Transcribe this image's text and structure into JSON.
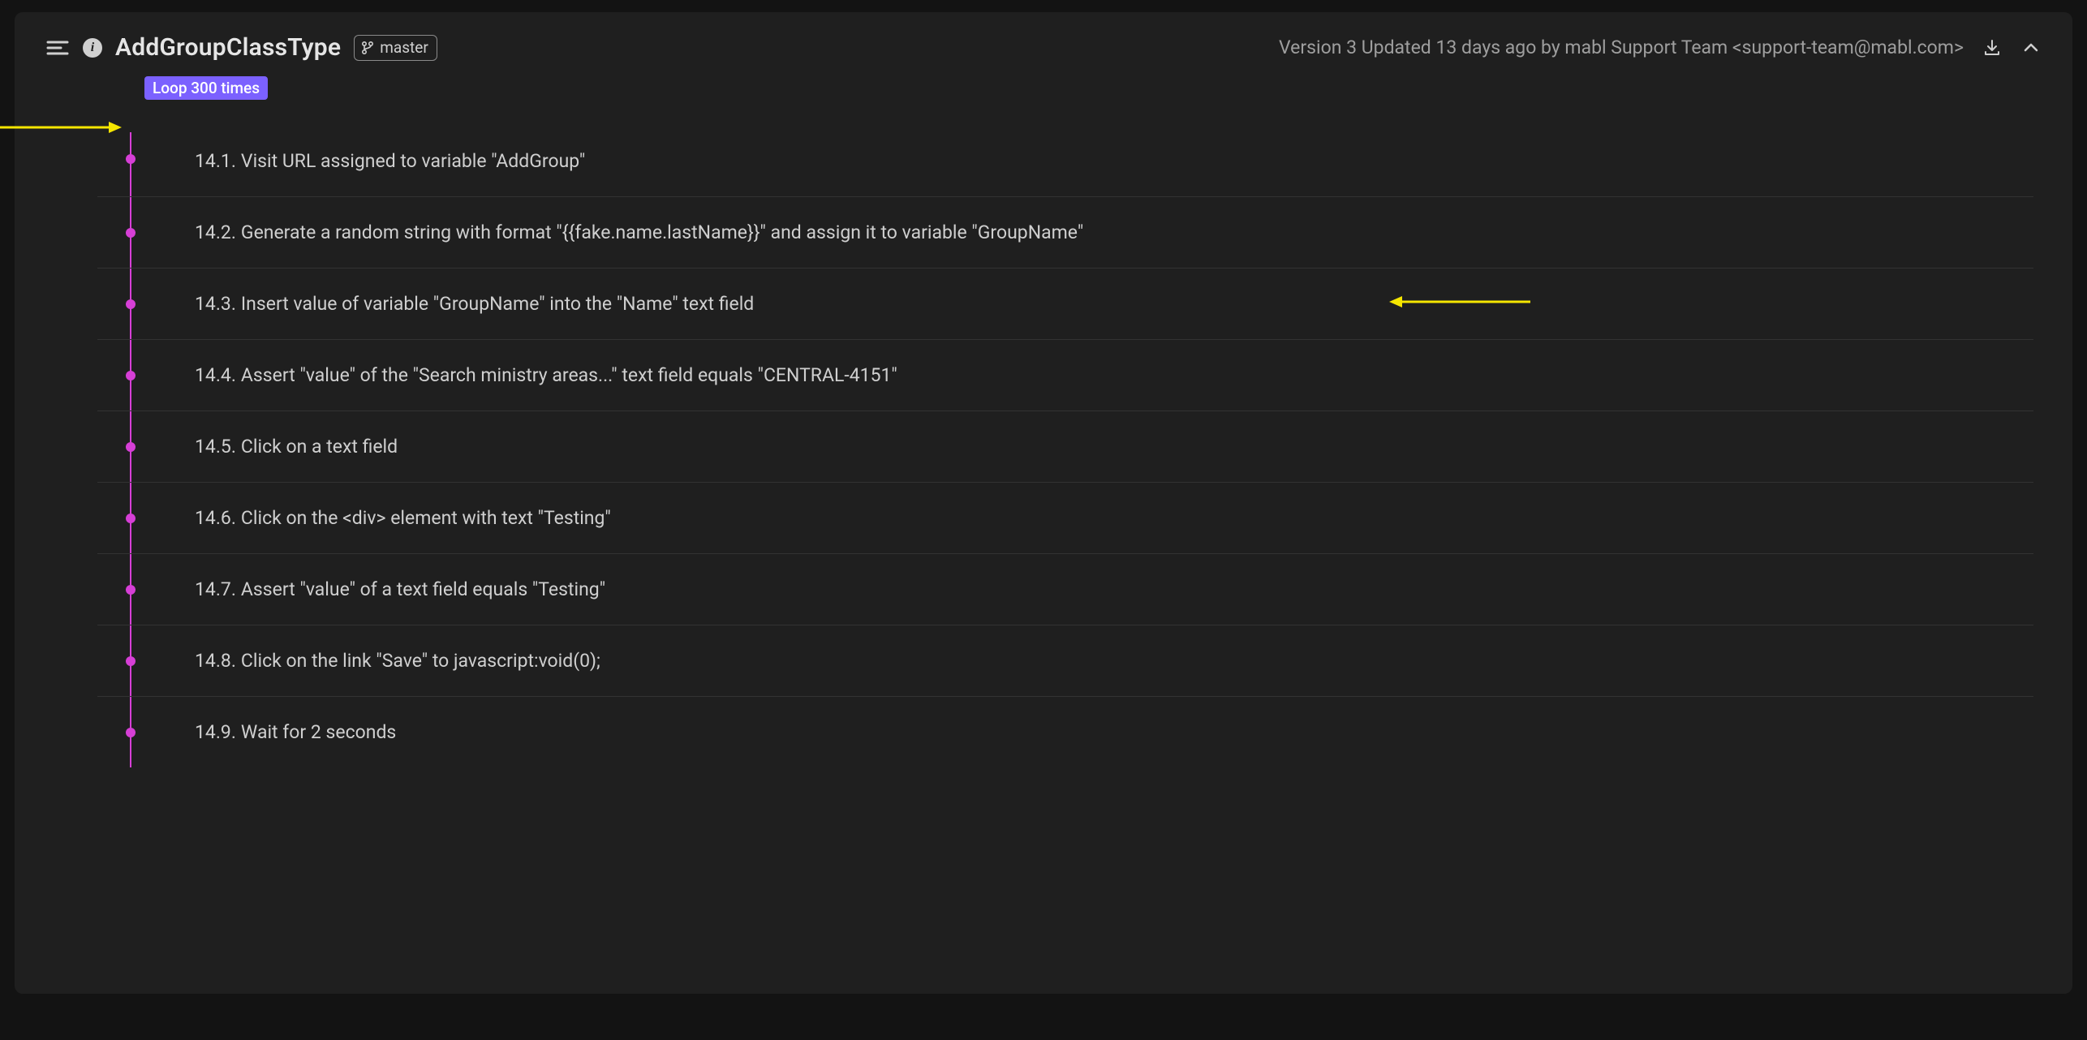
{
  "header": {
    "title": "AddGroupClassType",
    "branch": "master",
    "version_text": "Version 3 Updated 13 days ago by mabl Support Team <support-team@mabl.com>"
  },
  "loop_badge": "Loop 300 times",
  "steps": [
    {
      "num": "14.1.",
      "text": "Visit URL assigned to variable \"AddGroup\""
    },
    {
      "num": "14.2.",
      "text": "Generate a random string with format \"{{fake.name.lastName}}\" and assign it to variable \"GroupName\""
    },
    {
      "num": "14.3.",
      "text": "Insert value of variable \"GroupName\" into the \"Name\" text field"
    },
    {
      "num": "14.4.",
      "text": "Assert \"value\" of the \"Search ministry areas...\" text field equals \"CENTRAL-4151\""
    },
    {
      "num": "14.5.",
      "text": "Click on a text field"
    },
    {
      "num": "14.6.",
      "text": "Click on the <div> element with text \"Testing\""
    },
    {
      "num": "14.7.",
      "text": "Assert \"value\" of a text field equals \"Testing\""
    },
    {
      "num": "14.8.",
      "text": "Click on the link \"Save\" to javascript:void(0);"
    },
    {
      "num": "14.9.",
      "text": "Wait for 2 seconds"
    }
  ],
  "colors": {
    "accent_purple": "#7b61ff",
    "magenta": "#d63fd6",
    "annotation_yellow": "#f5e600"
  }
}
